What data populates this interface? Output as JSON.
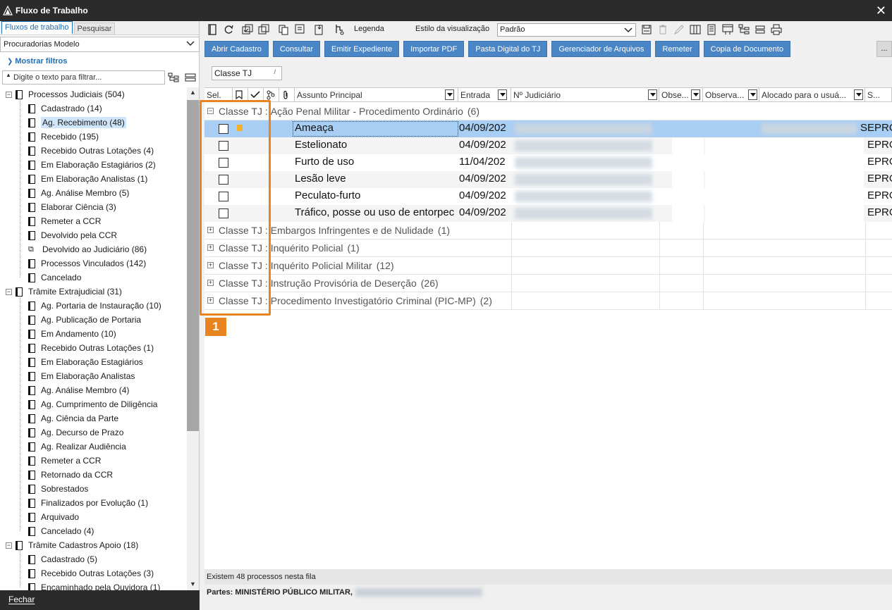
{
  "window": {
    "title": "Fluxo de Trabalho"
  },
  "left": {
    "tabs": [
      {
        "label": "Fluxos de trabalho"
      },
      {
        "label": "Pesquisar"
      }
    ],
    "model_select": "Procuradorias Modelo",
    "show_filters": "Mostrar filtros",
    "filter_placeholder": "Digite o texto para filtrar...",
    "tree": [
      {
        "label": "Processos Judiciais (504)",
        "level": 0
      },
      {
        "label": "Cadastrado (14)",
        "level": 1
      },
      {
        "label": "Ag. Recebimento (48)",
        "level": 1,
        "selected": true
      },
      {
        "label": "Recebido (195)",
        "level": 1
      },
      {
        "label": "Recebido Outras Lotações (4)",
        "level": 1
      },
      {
        "label": "Em Elaboração Estagiários (2)",
        "level": 1
      },
      {
        "label": "Em Elaboração Analistas (1)",
        "level": 1
      },
      {
        "label": "Ag. Análise Membro (5)",
        "level": 1
      },
      {
        "label": "Elaborar Ciência (3)",
        "level": 1
      },
      {
        "label": "Remeter a CCR",
        "level": 1
      },
      {
        "label": "Devolvido pela CCR",
        "level": 1
      },
      {
        "label": "Devolvido ao Judiciário (86)",
        "level": 1,
        "special": true
      },
      {
        "label": "Processos Vinculados (142)",
        "level": 1
      },
      {
        "label": "Cancelado",
        "level": 1
      },
      {
        "label": "Trâmite Extrajudicial (31)",
        "level": 0
      },
      {
        "label": "Ag. Portaria de Instauração (10)",
        "level": 1
      },
      {
        "label": "Ag. Publicação de Portaria",
        "level": 1
      },
      {
        "label": "Em Andamento (10)",
        "level": 1
      },
      {
        "label": "Recebido Outras Lotações (1)",
        "level": 1
      },
      {
        "label": "Em Elaboração Estagiários",
        "level": 1
      },
      {
        "label": "Em Elaboração Analistas",
        "level": 1
      },
      {
        "label": "Ag. Análise Membro (4)",
        "level": 1
      },
      {
        "label": "Ag. Cumprimento de Diligência",
        "level": 1
      },
      {
        "label": "Ag. Ciência da Parte",
        "level": 1
      },
      {
        "label": "Ag. Decurso de Prazo",
        "level": 1
      },
      {
        "label": "Ag. Realizar Audiência",
        "level": 1
      },
      {
        "label": "Remeter a CCR",
        "level": 1
      },
      {
        "label": "Retornado da CCR",
        "level": 1
      },
      {
        "label": "Sobrestados",
        "level": 1
      },
      {
        "label": "Finalizados por Evolução (1)",
        "level": 1
      },
      {
        "label": "Arquivado",
        "level": 1
      },
      {
        "label": "Cancelado (4)",
        "level": 1
      },
      {
        "label": "Trâmite Cadastros Apoio (18)",
        "level": 0
      },
      {
        "label": "Cadastrado (5)",
        "level": 1
      },
      {
        "label": "Recebido Outras Lotações (3)",
        "level": 1
      },
      {
        "label": "Encaminhado pela Ouvidora (1)",
        "level": 1
      }
    ],
    "close_label": "Fechar"
  },
  "toolbar": {
    "legend_label": "Legenda",
    "view_style_label": "Estilo da visualização",
    "view_style_value": "Padrão"
  },
  "buttons": [
    "Abrir Cadastro",
    "Consultar",
    "Emitir Expediente",
    "Importar PDF",
    "Pasta Digital do TJ",
    "Gerenciador de Arquivos",
    "Remeter",
    "Copia de Documento"
  ],
  "more_label": "...",
  "group_chip": "Classe TJ",
  "grid": {
    "columns": {
      "sel": "Sel.",
      "assunto": "Assunto Principal",
      "entrada": "Entrada",
      "numero": "Nº Judiciário",
      "obs1": "Obse...",
      "obs2": "Observa...",
      "alocado": "Alocado para o usuá...",
      "s": "S..."
    },
    "group_prefix": "Classe TJ :",
    "groups": [
      {
        "title": "Ação Penal Militar - Procedimento Ordinário",
        "count": "(6)",
        "expanded": true,
        "rows": [
          {
            "subject": "Ameaça",
            "date": "04/09/202",
            "system": "EPRO",
            "selected": true,
            "flag": true
          },
          {
            "subject": "Estelionato",
            "date": "04/09/202",
            "system": "EPRO"
          },
          {
            "subject": "Furto de uso",
            "date": "11/04/202",
            "system": "EPRO"
          },
          {
            "subject": "Lesão leve",
            "date": "04/09/202",
            "system": "EPRO"
          },
          {
            "subject": "Peculato-furto",
            "date": "04/09/202",
            "system": "EPRO"
          },
          {
            "subject": "Tráfico, posse ou uso de entorpec",
            "date": "04/09/202",
            "system": "EPRO"
          }
        ]
      },
      {
        "title": "Embargos Infringentes e de Nulidade",
        "count": "(1)"
      },
      {
        "title": "Inquérito Policial",
        "count": "(1)"
      },
      {
        "title": "Inquérito Policial Militar",
        "count": "(12)"
      },
      {
        "title": "Instrução Provisória de Deserção",
        "count": "(26)"
      },
      {
        "title": "Procedimento Investigatório Criminal (PIC-MP)",
        "count": "(2)"
      }
    ],
    "selected_row_tail": "S"
  },
  "highlight_badge": "1",
  "status": {
    "count_text": "Existem 48 processos nesta fila",
    "parties_text": "Partes: MINISTÉRIO PÚBLICO MILITAR,"
  },
  "colors": {
    "accent": "#4a86c6",
    "highlight": "#e8841f",
    "selected_row": "#a9cef3",
    "titlebar": "#2b2b2b"
  }
}
